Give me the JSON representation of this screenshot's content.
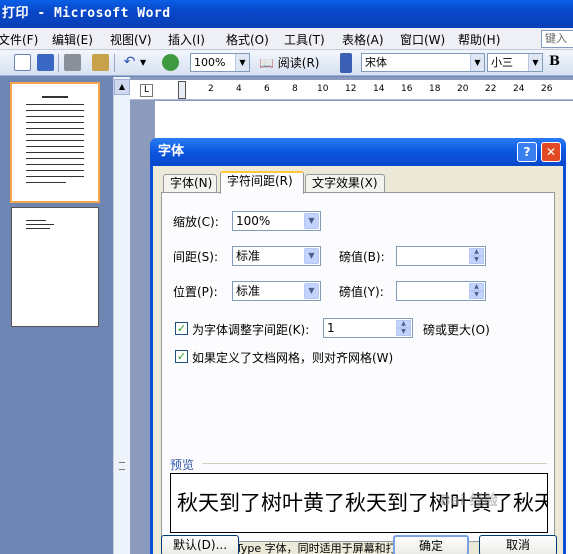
{
  "window": {
    "title": "打印 - Microsoft Word"
  },
  "menu": {
    "items": [
      "文件(F)",
      "编辑(E)",
      "视图(V)",
      "插入(I)",
      "格式(O)",
      "工具(T)",
      "表格(A)",
      "窗口(W)",
      "帮助(H)"
    ],
    "help_box": "键入"
  },
  "toolbar": {
    "zoom": "100%",
    "read_label": "阅读(R)",
    "font_name": "宋体",
    "font_size": "小三",
    "bold_label": "B"
  },
  "ruler": {
    "corner": "L",
    "ticks": [
      "2",
      "4",
      "6",
      "8",
      "10",
      "12",
      "14",
      "16",
      "18",
      "20",
      "22",
      "24",
      "26"
    ]
  },
  "dialog": {
    "title": "字体",
    "help": "?",
    "close": "✕",
    "tabs": [
      "字体(N)",
      "字符间距(R)",
      "文字效果(X)"
    ],
    "active_tab": 1,
    "scale": {
      "label": "缩放(C):",
      "value": "100%"
    },
    "spacing": {
      "label": "间距(S):",
      "value": "标准",
      "pt_label": "磅值(B):",
      "pt_value": ""
    },
    "position": {
      "label": "位置(P):",
      "value": "标准",
      "pt_label": "磅值(Y):",
      "pt_value": ""
    },
    "kerning": {
      "checked": true,
      "label": "为字体调整字间距(K):",
      "value": "1",
      "suffix": "磅或更大(O)"
    },
    "grid": {
      "checked": true,
      "label": "如果定义了文档网格，则对齐网格(W)"
    },
    "preview_label": "预览",
    "preview_text": "秋天到了树叶黄了秋天到了树叶黄了秋天到",
    "note": "这是一种 TrueType 字体，同时适用于屏幕和打印机。",
    "buttons": {
      "default": "默认(D)...",
      "ok": "确定",
      "cancel": "取消"
    }
  },
  "watermark": "Bai 经验"
}
